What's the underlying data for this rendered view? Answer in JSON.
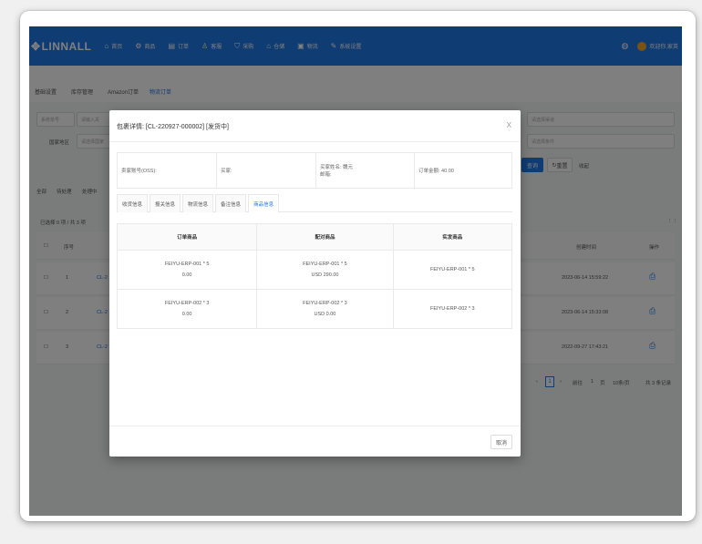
{
  "nav": {
    "logo": "LINNALL",
    "items": [
      {
        "icon": "home-icon",
        "glyph": "⌂",
        "label": "首页"
      },
      {
        "icon": "product-icon",
        "glyph": "⚙",
        "label": "商品"
      },
      {
        "icon": "order-icon",
        "glyph": "▤",
        "label": "订单"
      },
      {
        "icon": "customer-icon",
        "glyph": "♙",
        "label": "客服"
      },
      {
        "icon": "purchase-icon",
        "glyph": "⛉",
        "label": "采购"
      },
      {
        "icon": "warehouse-icon",
        "glyph": "⌂",
        "label": "仓储"
      },
      {
        "icon": "logistics-icon",
        "glyph": "▣",
        "label": "物流"
      },
      {
        "icon": "settings-icon",
        "glyph": "✎",
        "label": "系统设置"
      }
    ],
    "user_label": "欢迎你,家英"
  },
  "subtabs": [
    "基础设置",
    "库存管理",
    "Amazon订单",
    "物流订单"
  ],
  "background": {
    "filter_select": "系统单号",
    "filter_input_placeholder": "请输入关",
    "country_label": "国家地区",
    "country_placeholder": "请选择国家",
    "right_select_placeholder": "请选择渠道",
    "right_select2_placeholder": "请选择条件",
    "search_button": "查询",
    "reset_button": "重置",
    "collapse_label": "收起",
    "status_tabs": [
      "全部",
      "待处理",
      "处理中"
    ],
    "selected_text": "已选择 0 项 / 共 3 项",
    "col_index": "序号",
    "col_created": "创建时间",
    "col_actions": "操作",
    "rows": [
      {
        "index": "1",
        "id": "CL-2",
        "created": "2023-06-14 15:59:22"
      },
      {
        "index": "2",
        "id": "CL-2",
        "created": "2023-06-14 15:33:08"
      },
      {
        "index": "3",
        "id": "CL-2",
        "created": "2022-09-27 17:43:21"
      }
    ],
    "pagination": {
      "current": "1",
      "goto_label": "前往",
      "goto_value": "1",
      "page_unit": "页",
      "page_size": "10条/页",
      "total": "共 3 条记录"
    }
  },
  "modal": {
    "title": "包裹详情: [CL-220927-000002] [发货中]",
    "close_label": "X",
    "info": {
      "seller": "卖家账号(OSS):",
      "buyer": "买家:",
      "buyer_name": "买家姓名: 魏元",
      "email": "邮箱:",
      "order_amount": "订单金额: 40.00"
    },
    "tabs": [
      "收货信息",
      "报关信息",
      "物流信息",
      "备注信息",
      "商品信息"
    ],
    "active_tab": 4,
    "table": {
      "headers": [
        "订单商品",
        "配对商品",
        "实发商品"
      ],
      "rows": [
        {
          "order_sku": "FEIYU-ERP-001 * 5",
          "order_price": "0.00",
          "match_sku": "FEIYU-ERP-001 * 5",
          "match_price": "USD 290.00",
          "actual": "FEIYU-ERP-001 * 5"
        },
        {
          "order_sku": "FEIYU-ERP-002 * 3",
          "order_price": "0.00",
          "match_sku": "FEIYU-ERP-002 * 3",
          "match_price": "USD 0.00",
          "actual": "FEIYU-ERP-002 * 3"
        }
      ]
    },
    "cancel_label": "取消"
  },
  "colors": {
    "primary": "#1e78e6",
    "overlay": "rgba(0,0,0,0.5)",
    "avatar": "#f5a623"
  }
}
